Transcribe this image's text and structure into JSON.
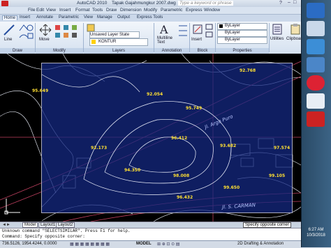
{
  "title_bar": {
    "app": "AutoCAD 2010",
    "document": "Tapak Gajahmungkur 2007.dwg",
    "search_placeholder": "Type a keyword or phrase"
  },
  "menus": [
    "File",
    "Edit",
    "View",
    "Insert",
    "Format",
    "Tools",
    "Draw",
    "Dimension",
    "Modify",
    "Parametric",
    "Express",
    "Window"
  ],
  "ribbon_tabs": [
    "Home",
    "Insert",
    "Annotate",
    "Parametric",
    "View",
    "Manage",
    "Output",
    "Express Tools"
  ],
  "ribbon": {
    "line": "Line",
    "move": "Move",
    "layer_state": "Unsaved Layer State",
    "layer_name": "KONTUR",
    "multiline_text": "Multiline Text",
    "insert": "Insert",
    "bylayer": "ByLayer",
    "utilities": "Utilities",
    "clipboard": "Clipboard",
    "panels": {
      "draw": "Draw",
      "modify": "Modify",
      "layers": "Layers",
      "annotation": "Annotation",
      "block": "Block",
      "properties": "Properties"
    }
  },
  "drawing": {
    "elevations": [
      "92.768",
      "95.649",
      "92.054",
      "95.749",
      "96.412",
      "93.682",
      "92.173",
      "97.574",
      "94.350",
      "98.008",
      "99.105",
      "99.650",
      "96.432"
    ],
    "road_label_1": "Jl. Argo Puro",
    "road_label_2": "Jl. S. CARMAN",
    "fill_color": "#14288a",
    "contour_color": "#d8dce6",
    "road_color": "#c04060"
  },
  "layout_tabs": [
    "Model",
    "Layout1",
    "Layout2"
  ],
  "command_lines": [
    "Unknown command \"SELECTSIMILAR\".  Press F1 for help.",
    "Command: Specify opposite corner:"
  ],
  "tooltip": "Specify opposite corner",
  "status": {
    "coords": "736.5126, 1954.4244, 0.0000",
    "model": "MODEL",
    "workspace": "2D Drafting & Annotation"
  },
  "clock": {
    "time": "6:27 AM",
    "date": "10/3/2018"
  }
}
